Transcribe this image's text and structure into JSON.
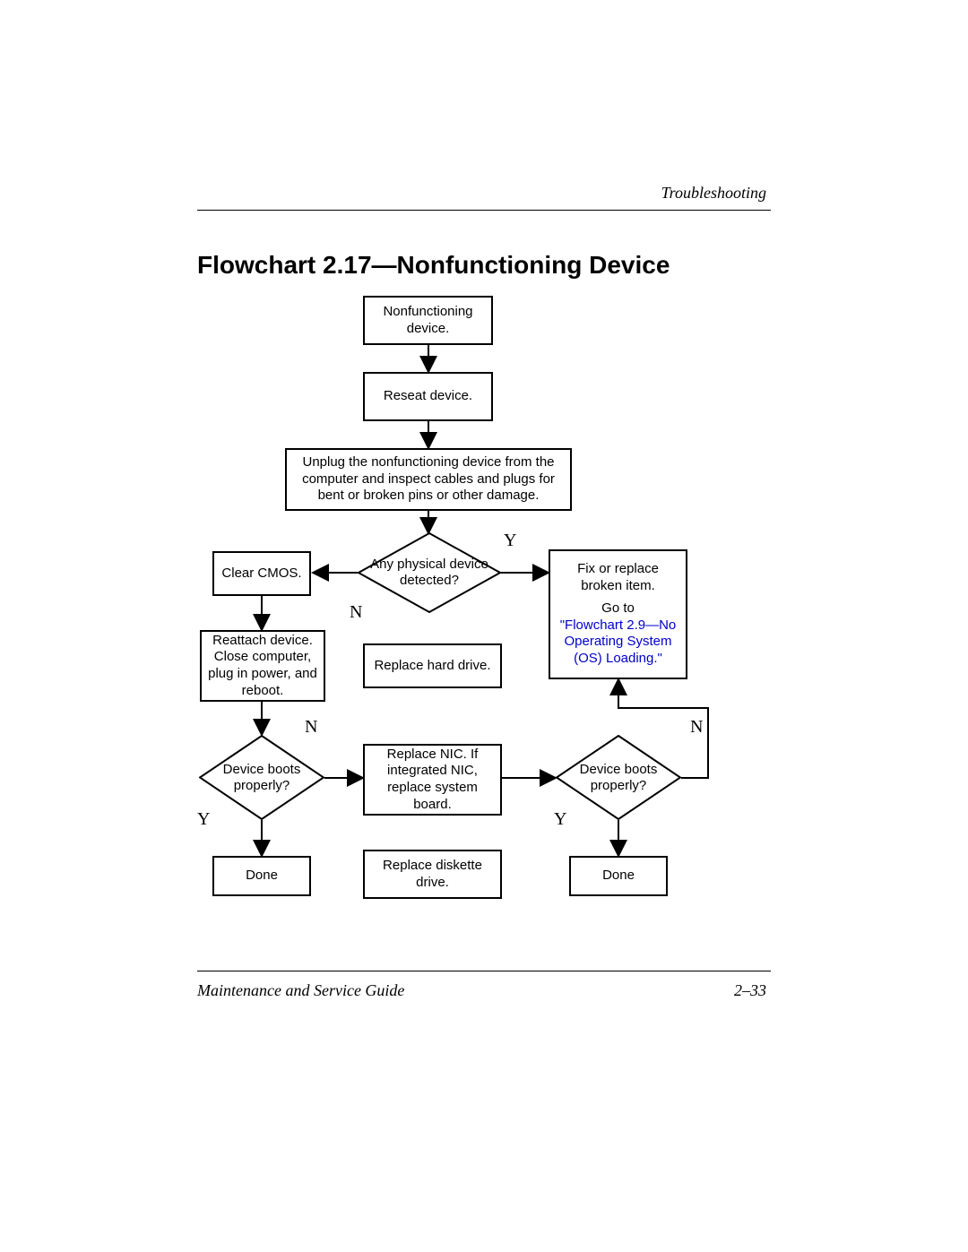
{
  "header": {
    "section": "Troubleshooting"
  },
  "title": "Flowchart 2.17—Nonfunctioning Device",
  "nodes": {
    "n1": "Nonfunctioning device.",
    "n2": "Reseat device.",
    "n3": "Unplug the nonfunctioning device from the computer and inspect cables and plugs for bent or broken pins or other damage.",
    "d1": "Any physical device detected?",
    "n4": "Clear CMOS.",
    "n5_pre": "Fix or replace broken item.",
    "n6_pre": "Go to ",
    "n6_link": "\"Flowchart 2.9—No Operating System (OS) Loading.\"",
    "n7": "Reattach device. Close computer, plug in power, and reboot.",
    "n8": "Replace hard drive.",
    "d2": "Device boots properly?",
    "n9": "Replace NIC. If integrated NIC, replace system board.",
    "d3": "Device boots properly?",
    "n10": "Done",
    "n11": "Replace diskette drive.",
    "n12": "Done"
  },
  "labels": {
    "y": "Y",
    "n": "N"
  },
  "footer": {
    "left": "Maintenance and Service Guide",
    "right": "2–33"
  }
}
